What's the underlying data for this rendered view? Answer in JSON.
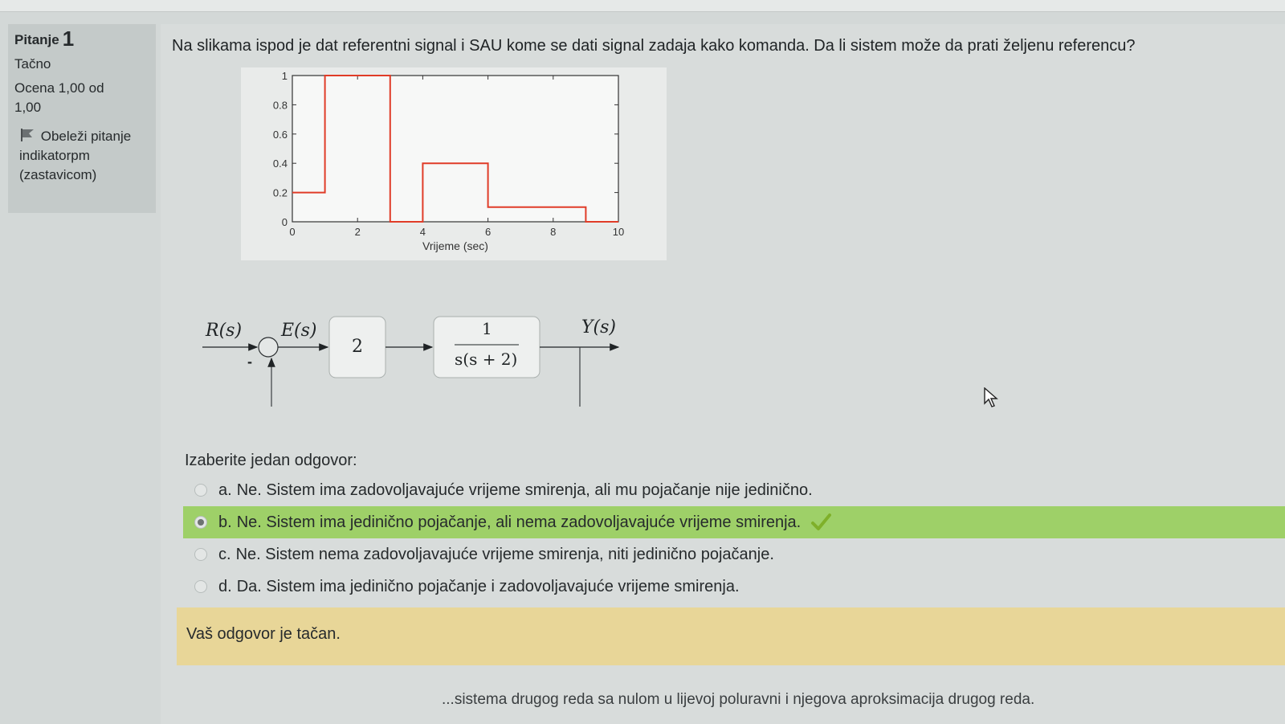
{
  "info": {
    "question_word": "Pitanje",
    "question_number": "1",
    "status": "Tačno",
    "grade_label": "Ocena 1,00 od",
    "grade_value": "1,00",
    "flag_text_1": "Obeleži pitanje",
    "flag_text_2": "indikatorpm",
    "flag_text_3": "(zastavicom)"
  },
  "question": {
    "text": "Na slikama ispod je dat referentni signal i SAU kome se dati signal zadaja kako komanda. Da li sistem može da prati željenu referencu?"
  },
  "chart_data": {
    "type": "line",
    "xlabel": "Vrijeme (sec)",
    "ylabel": "",
    "xlim": [
      0,
      10
    ],
    "ylim": [
      0,
      1
    ],
    "x_ticks": [
      0,
      2,
      4,
      6,
      8,
      10
    ],
    "y_ticks": [
      0,
      0.2,
      0.4,
      0.6,
      0.8,
      1
    ],
    "x_tick_labels": [
      "0",
      "2",
      "4",
      "6",
      "8",
      "10"
    ],
    "y_tick_labels": [
      "0",
      "0.2",
      "0.4",
      "0.6",
      "0.8",
      "1"
    ],
    "grid": false,
    "color": "#e03c28",
    "series": [
      {
        "x": [
          0,
          1,
          1,
          3,
          3,
          4,
          4,
          6,
          6,
          9,
          9,
          10
        ],
        "y": [
          0.2,
          0.2,
          1,
          1,
          0,
          0,
          0.4,
          0.4,
          0.1,
          0.1,
          0,
          0
        ]
      }
    ]
  },
  "diagram": {
    "input_label": "R(s)",
    "error_label": "E(s)",
    "gain": "2",
    "tf_numerator": "1",
    "tf_denominator": "s(s + 2)",
    "output_label": "Y(s)",
    "minus_sign": "-"
  },
  "answers": {
    "prompt": "Izaberite jedan odgovor:",
    "options": [
      {
        "letter": "a.",
        "text": "Ne. Sistem ima zadovoljavajuće vrijeme smirenja, ali mu pojačanje nije jedinično.",
        "selected": false
      },
      {
        "letter": "b.",
        "text": "Ne. Sistem ima jedinično pojačanje, ali nema zadovoljavajuće vrijeme smirenja.",
        "selected": true
      },
      {
        "letter": "c.",
        "text": "Ne. Sistem nema zadovoljavajuće vrijeme smirenja, niti jedinično pojačanje.",
        "selected": false
      },
      {
        "letter": "d.",
        "text": "Da. Sistem ima jedinično pojačanje i zadovoljavajuće vrijeme smirenja.",
        "selected": false
      }
    ]
  },
  "feedback": {
    "text": "Vaš odgovor je tačan."
  },
  "next_question": {
    "text": "...sistema drugog reda sa nulom u lijevoj poluravni i njegova aproksimacija drugog reda."
  },
  "colors": {
    "correct_bg": "#9ed068",
    "feedback_bg": "#e8d698",
    "check": "#7fb02a",
    "signal": "#e03c28"
  }
}
